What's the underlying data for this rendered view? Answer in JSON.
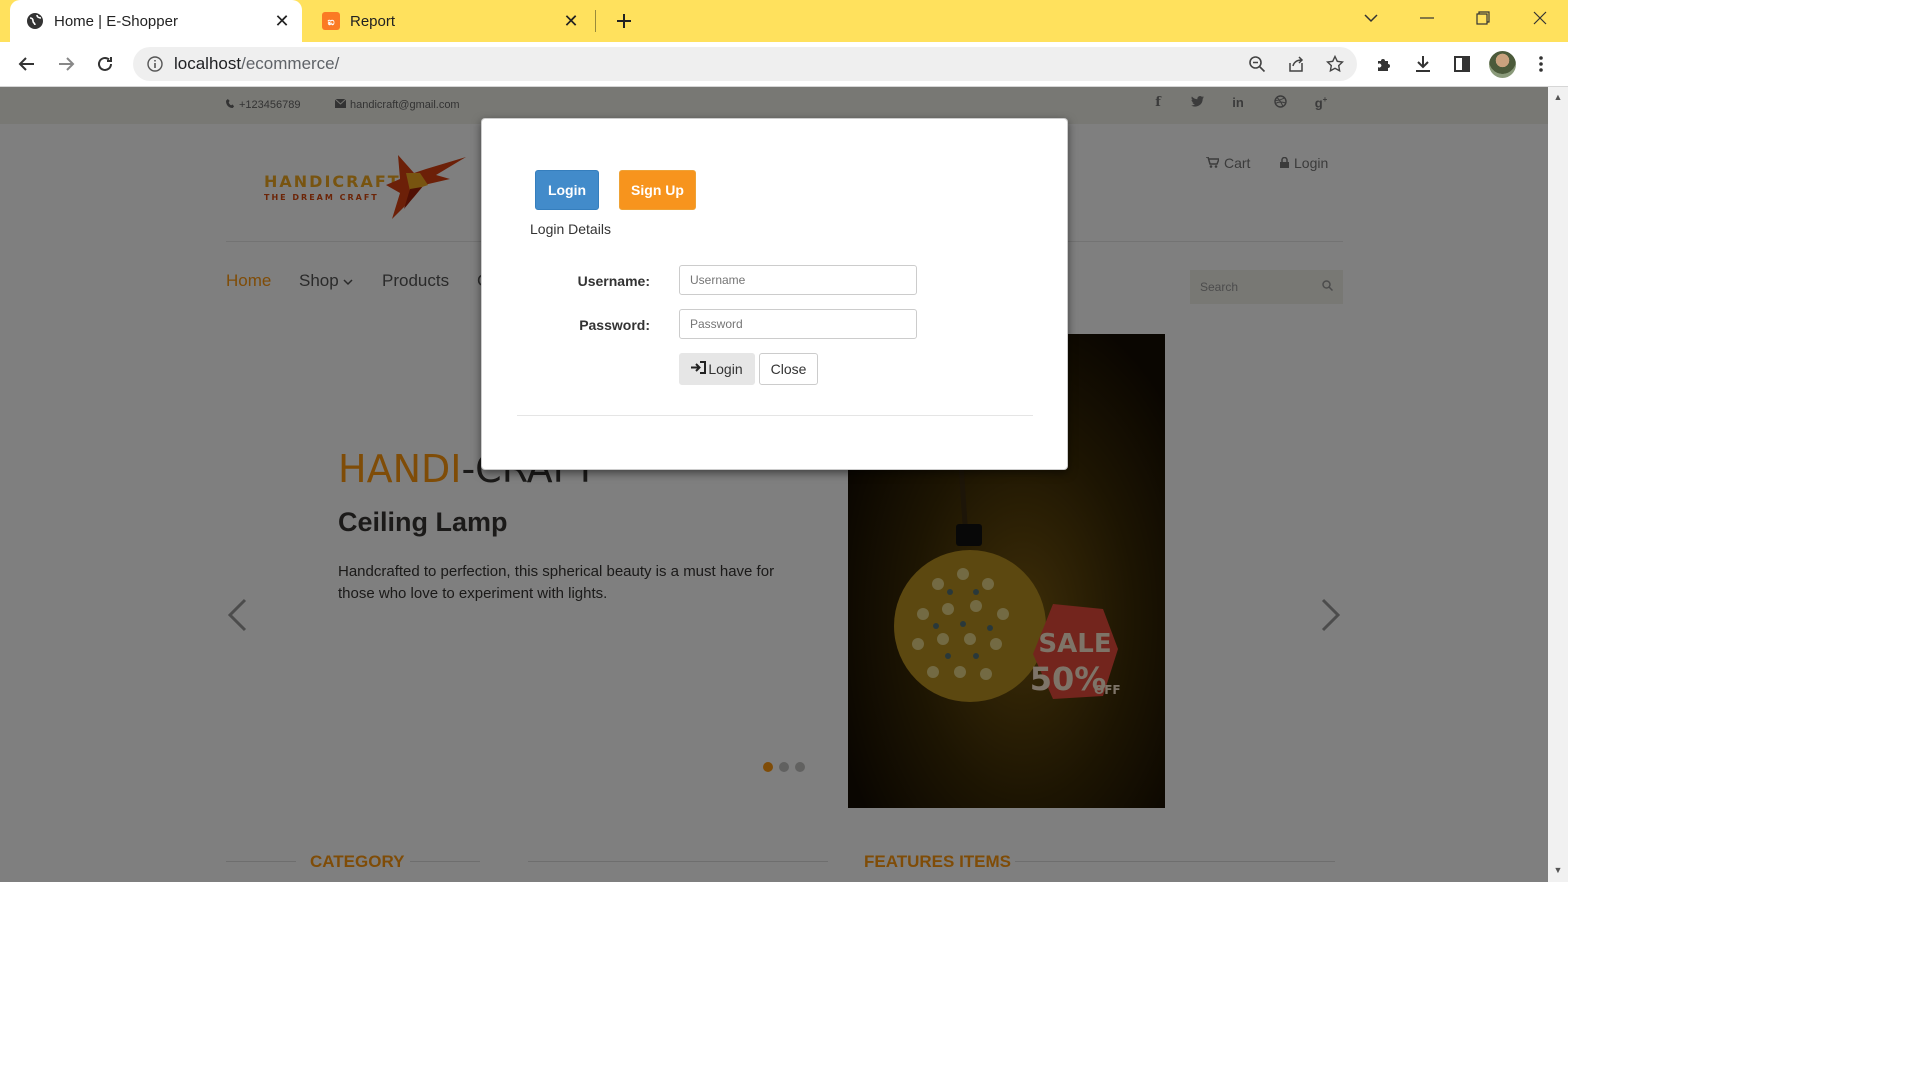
{
  "browser": {
    "tabs": [
      {
        "title": "Home | E-Shopper",
        "favicon": "globe-icon",
        "active": true
      },
      {
        "title": "Report",
        "favicon": "xampp-icon",
        "active": false
      }
    ],
    "url_host": "localhost",
    "url_path": "/ecommerce/",
    "accent": "#ffe15d"
  },
  "topbar": {
    "phone": "+123456789",
    "email": "handicraft@gmail.com",
    "social": [
      "f",
      "t",
      "in",
      "dribbble",
      "g+"
    ]
  },
  "header": {
    "logo_line1": "HANDICRAFT",
    "logo_line2": "THE DREAM CRAFT",
    "cart": "Cart",
    "login": "Login"
  },
  "nav": {
    "items": [
      "Home",
      "Shop",
      "Products",
      "C"
    ],
    "active": "Home",
    "search_placeholder": "Search"
  },
  "slider": {
    "title_a": "HANDI",
    "title_b": "-CRAFT",
    "subtitle": "Ceiling Lamp",
    "description": "Handcrafted to perfection, this spherical beauty is a must have for those who love to experiment with lights.",
    "sale_line1": "SALE",
    "sale_line2": "50%",
    "sale_line3": "OFF",
    "active_dot": 0,
    "dot_count": 3
  },
  "sections": {
    "category": "CATEGORY",
    "features": "FEATURES ITEMS"
  },
  "modal": {
    "tab_login": "Login",
    "tab_signup": "Sign Up",
    "details_label": "Login Details",
    "username_label": "Username:",
    "username_placeholder": "Username",
    "password_label": "Password:",
    "password_placeholder": "Password",
    "submit_label": "Login",
    "close_label": "Close"
  },
  "colors": {
    "brand_orange": "#fe980f",
    "primary_blue": "#428bca",
    "signup_orange": "#f7941d"
  }
}
